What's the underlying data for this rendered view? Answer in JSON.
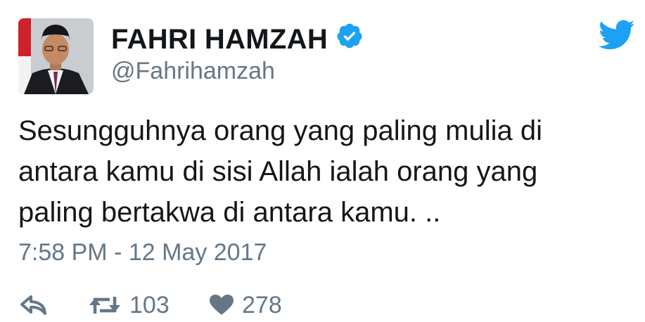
{
  "author": {
    "display_name": "FAHRI HAMZAH",
    "handle": "@Fahrihamzah",
    "verified": true,
    "avatar_icon": "profile-photo"
  },
  "tweet": {
    "text_lines": [
      "Sesungguhnya orang yang paling mulia di",
      "antara kamu di sisi Allah ialah orang yang",
      "paling bertakwa di antara kamu. .."
    ],
    "timestamp": "7:58 PM - 12 May 2017"
  },
  "actions": {
    "reply_icon": "reply-icon",
    "retweet_icon": "retweet-icon",
    "retweet_count": "103",
    "like_icon": "heart-icon",
    "like_count": "278"
  },
  "branding": {
    "logo_icon": "twitter-bird-icon"
  },
  "colors": {
    "accent": "#1da1f2",
    "text_primary": "#14171a",
    "text_secondary": "#657786"
  }
}
